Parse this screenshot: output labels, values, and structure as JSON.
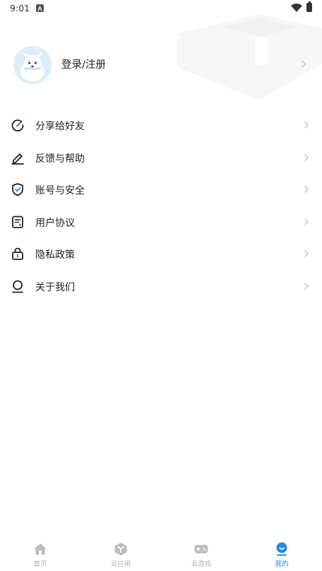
{
  "status_bar": {
    "time": "9:01"
  },
  "profile": {
    "login_label": "登录/注册"
  },
  "menu": {
    "items": [
      {
        "label": "分享给好友",
        "icon": "share-icon"
      },
      {
        "label": "反馈与帮助",
        "icon": "pencil-icon"
      },
      {
        "label": "账号与安全",
        "icon": "shield-icon"
      },
      {
        "label": "用户协议",
        "icon": "document-icon"
      },
      {
        "label": "隐私政策",
        "icon": "lock-icon"
      },
      {
        "label": "关于我们",
        "icon": "person-icon"
      }
    ]
  },
  "tabbar": {
    "tabs": [
      {
        "label": "首页",
        "icon": "home-icon",
        "active": false
      },
      {
        "label": "云应用",
        "icon": "cloud-app-icon",
        "active": false
      },
      {
        "label": "云游戏",
        "icon": "gamepad-icon",
        "active": false
      },
      {
        "label": "我的",
        "icon": "profile-icon",
        "active": true
      }
    ]
  },
  "colors": {
    "accent": "#1a8cf0",
    "inactive": "#aab0b8",
    "text": "#222222",
    "chevron": "#c4c8cc"
  }
}
